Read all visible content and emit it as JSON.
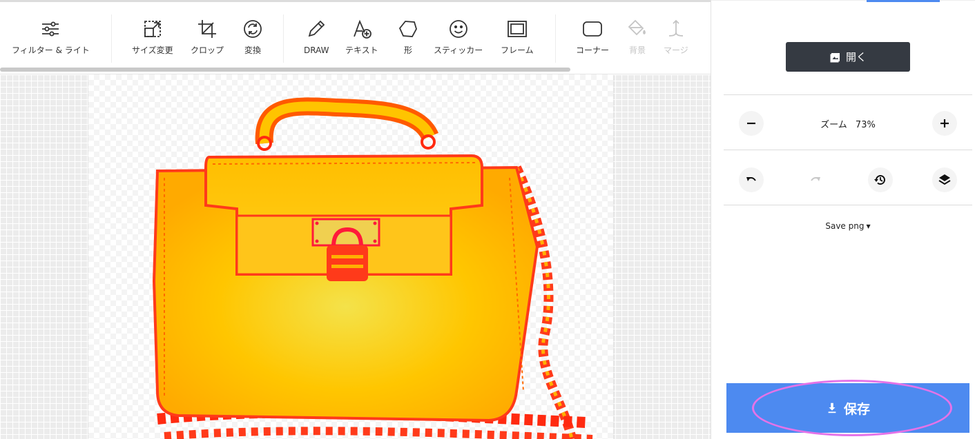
{
  "toolbar": {
    "tools": [
      {
        "label": "フィルター & ライト",
        "icon": "sliders-icon",
        "enabled": true
      },
      {
        "label": "サイズ変更",
        "icon": "resize-icon",
        "enabled": true
      },
      {
        "label": "クロップ",
        "icon": "crop-icon",
        "enabled": true
      },
      {
        "label": "変換",
        "icon": "rotate-icon",
        "enabled": true
      },
      {
        "label": "DRAW",
        "icon": "pencil-icon",
        "enabled": true
      },
      {
        "label": "テキスト",
        "icon": "text-icon",
        "enabled": true
      },
      {
        "label": "形",
        "icon": "shape-icon",
        "enabled": true
      },
      {
        "label": "スティッカー",
        "icon": "smiley-icon",
        "enabled": true
      },
      {
        "label": "フレーム",
        "icon": "frame-icon",
        "enabled": true
      },
      {
        "label": "コーナー",
        "icon": "corner-icon",
        "enabled": true
      },
      {
        "label": "背景",
        "icon": "paint-bucket-icon",
        "enabled": false
      },
      {
        "label": "マージ",
        "icon": "merge-icon",
        "enabled": false
      }
    ]
  },
  "sidebar": {
    "open_label": "開く",
    "zoom": {
      "label": "ズーム",
      "value": "73%"
    },
    "save_format_label": "Save png",
    "save_label": "保存"
  },
  "colors": {
    "open_button_bg": "#353a42",
    "save_button_bg": "#4d8af0",
    "highlight": "#e473e8",
    "accent_top": "#4d8af0"
  }
}
